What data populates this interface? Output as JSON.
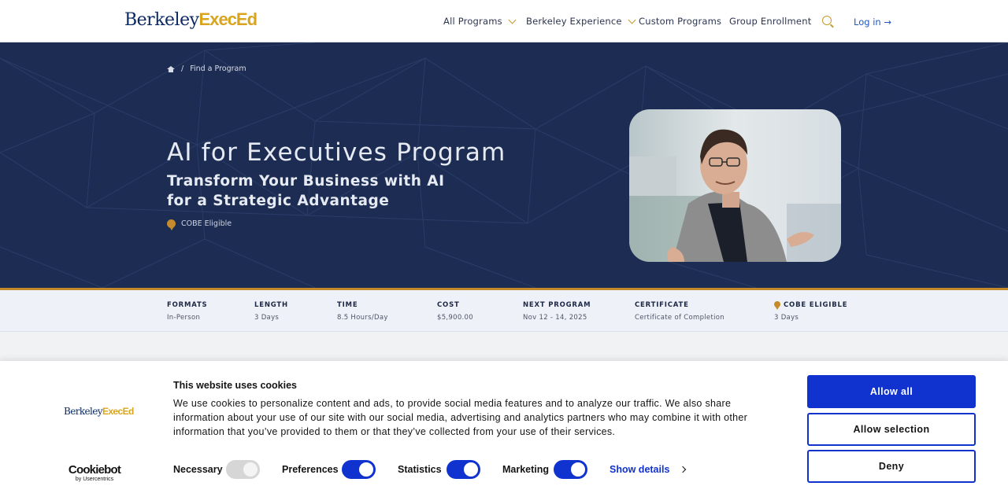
{
  "header": {
    "logo_part1": "Berkeley",
    "logo_part2": "ExecEd",
    "nav": [
      {
        "label": "All Programs",
        "has_dropdown": true
      },
      {
        "label": "Berkeley Experience",
        "has_dropdown": true
      },
      {
        "label": "Custom Programs",
        "has_dropdown": false
      },
      {
        "label": "Group Enrollment",
        "has_dropdown": false
      }
    ],
    "login_label": "Log in →"
  },
  "hero": {
    "breadcrumb_sep": "/",
    "breadcrumb_current": "Find a Program",
    "title": "AI for Executives Program",
    "subtitle": "Transform Your Business with AI for a Strategic Advantage",
    "cobe_label": "COBE Eligible"
  },
  "facts": [
    {
      "label": "FORMATS",
      "value": "In-Person"
    },
    {
      "label": "LENGTH",
      "value": "3 Days"
    },
    {
      "label": "TIME",
      "value": "8.5 Hours/Day"
    },
    {
      "label": "COST",
      "value": "$5,900.00"
    },
    {
      "label": "NEXT PROGRAM",
      "value": "Nov 12 - 14, 2025"
    },
    {
      "label": "CERTIFICATE",
      "value": "Certificate of Completion"
    },
    {
      "label": "COBE ELIGIBLE",
      "value": "3 Days"
    }
  ],
  "cookie": {
    "logo_part1": "Berkeley",
    "logo_part2": "ExecEd",
    "brand_main": "Cookiebot",
    "brand_sub": "by Usercentrics",
    "title": "This website uses cookies",
    "text": "We use cookies to personalize content and ads, to provide social media features and to analyze our traffic. We also share information about your use of our site with our social media, advertising and analytics partners who may combine it with other information that you’ve provided to them or that they’ve collected from your use of their services.",
    "toggles": [
      {
        "label": "Necessary",
        "state": "disabled-on"
      },
      {
        "label": "Preferences",
        "state": "on"
      },
      {
        "label": "Statistics",
        "state": "on"
      },
      {
        "label": "Marketing",
        "state": "on"
      }
    ],
    "show_details": "Show details",
    "buttons": {
      "allow_all": "Allow all",
      "allow_selection": "Allow selection",
      "deny": "Deny"
    }
  },
  "colors": {
    "hero_bg": "#1d2c52",
    "gold": "#c28a2b",
    "cookie_blue": "#1032cf",
    "link_blue": "#1f56c4"
  }
}
